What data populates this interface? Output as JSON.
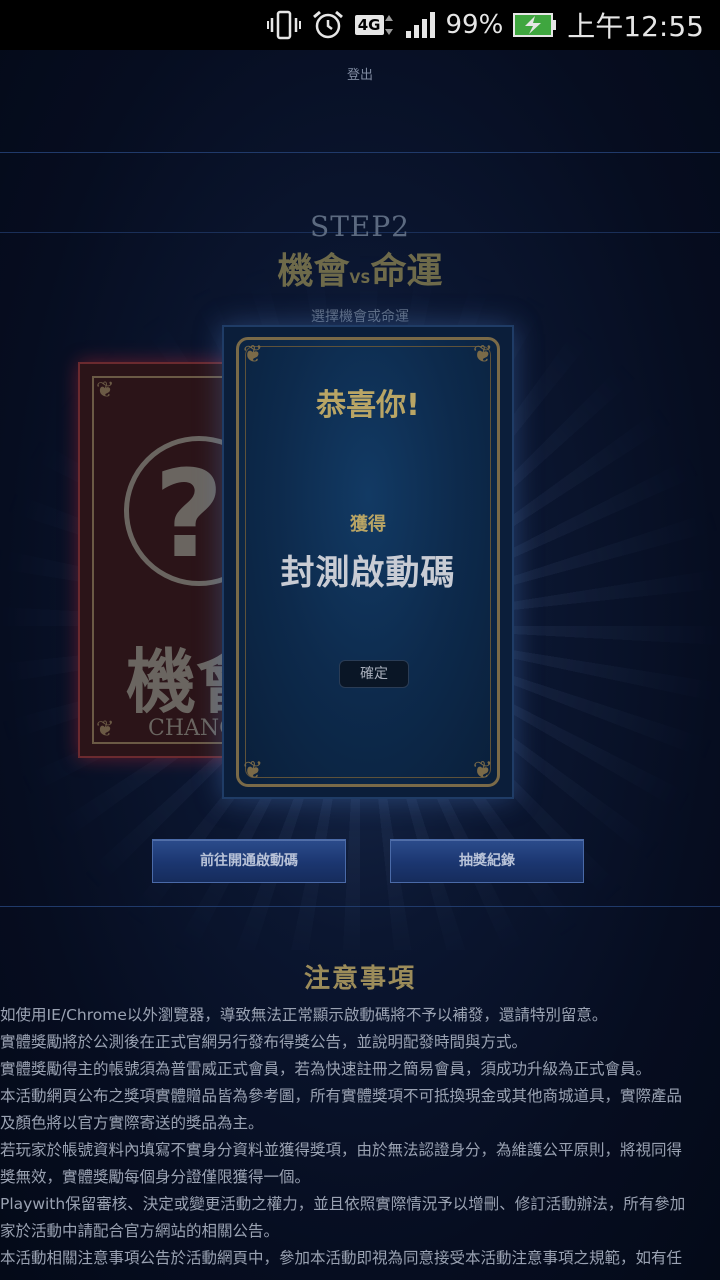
{
  "status_bar": {
    "icons": [
      "vibrate-icon",
      "alarm-icon",
      "lte-icon",
      "signal-icon",
      "battery-charging-icon"
    ],
    "lte_label": "4G",
    "battery_percent": "99%",
    "time": "上午12:55"
  },
  "header": {
    "logout_label": "登出"
  },
  "step": {
    "label": "STEP2",
    "title_left": "機會",
    "title_vs": "VS",
    "title_right": "命運",
    "subtitle": "選擇機會或命運"
  },
  "chance_card": {
    "question_mark": "?",
    "label_big": "機會",
    "label_en": "CHANCE"
  },
  "result_card": {
    "congrats": "恭喜你!",
    "got_label": "獲得",
    "prize": "封測啟動碼",
    "confirm_label": "確定"
  },
  "actions": {
    "activate_label": "前往開通啟動碼",
    "history_label": "抽獎紀錄"
  },
  "notes": {
    "title": "注意事項",
    "lines": [
      "如使用IE/Chrome以外瀏覽器，導致無法正常顯示啟動碼將不予以補發，還請特別留意。",
      "實體獎勵將於公測後在正式官網另行發布得獎公告，並說明配發時間與方式。",
      "實體獎勵得主的帳號須為普雷威正式會員，若為快速註冊之簡易會員，須成功升級為正式會員。",
      "本活動網頁公布之獎項實體贈品皆為參考圖，所有實體獎項不可抵換現金或其他商城道具，實際產品",
      "及顏色將以官方實際寄送的獎品為主。",
      "若玩家於帳號資料內填寫不實身分資料並獲得獎項，由於無法認證身分，為維護公平原則，將視同得",
      "獎無效，實體獎勵每個身分證僅限獲得一個。",
      "Playwith保留審核、決定或變更活動之權力，並且依照實際情況予以增刪、修訂活動辦法，所有參加",
      "家於活動中請配合官方網站的相關公告。",
      "本活動相關注意事項公告於活動網頁中，參加本活動即視為同意接受本活動注意事項之規範，如有任"
    ]
  }
}
